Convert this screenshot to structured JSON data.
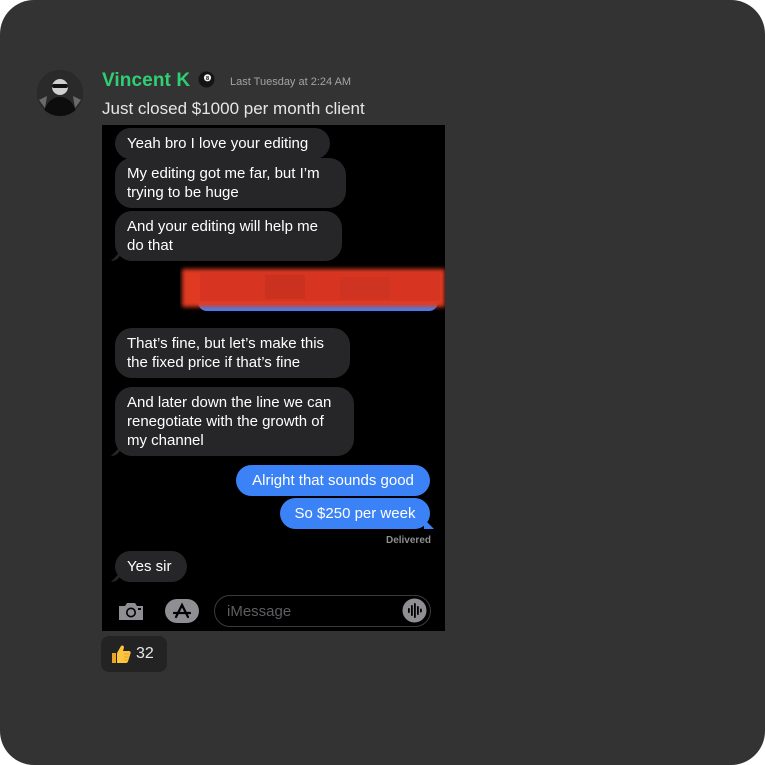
{
  "post": {
    "author": "Vincent K",
    "badge_icon": "eight-ball-icon",
    "timestamp": "Last Tuesday at 2:24 AM",
    "message": "Just closed $1000 per month client"
  },
  "screenshot": {
    "messages": [
      {
        "side": "in",
        "text": "Yeah bro I love your editing"
      },
      {
        "side": "in",
        "text": "My editing got me far, but I’m trying to be huge"
      },
      {
        "side": "in",
        "text": "And your editing will help me do that"
      },
      {
        "side": "out",
        "text": "",
        "redacted": true
      },
      {
        "side": "in",
        "text": "That’s fine, but let’s make this the fixed price if that’s fine"
      },
      {
        "side": "in",
        "text": "And later down the line we can renegotiate with the growth of my channel"
      },
      {
        "side": "out",
        "text": "Alright that sounds good"
      },
      {
        "side": "out",
        "text": "So $250 per week"
      },
      {
        "side": "in",
        "text": "Yes sir"
      }
    ],
    "delivered_label": "Delivered",
    "input_placeholder": "iMessage",
    "icons": {
      "camera": "camera-icon",
      "apps": "app-store-icon",
      "audio": "audio-waveform-icon"
    },
    "colors": {
      "incoming_bubble": "#262628",
      "outgoing_bubble": "#3b82f6",
      "redaction": "#e03a22"
    }
  },
  "reaction": {
    "emoji_icon": "thumbs-up-icon",
    "count": "32"
  },
  "colors": {
    "background": "#333333",
    "author_name": "#2fcf73"
  }
}
